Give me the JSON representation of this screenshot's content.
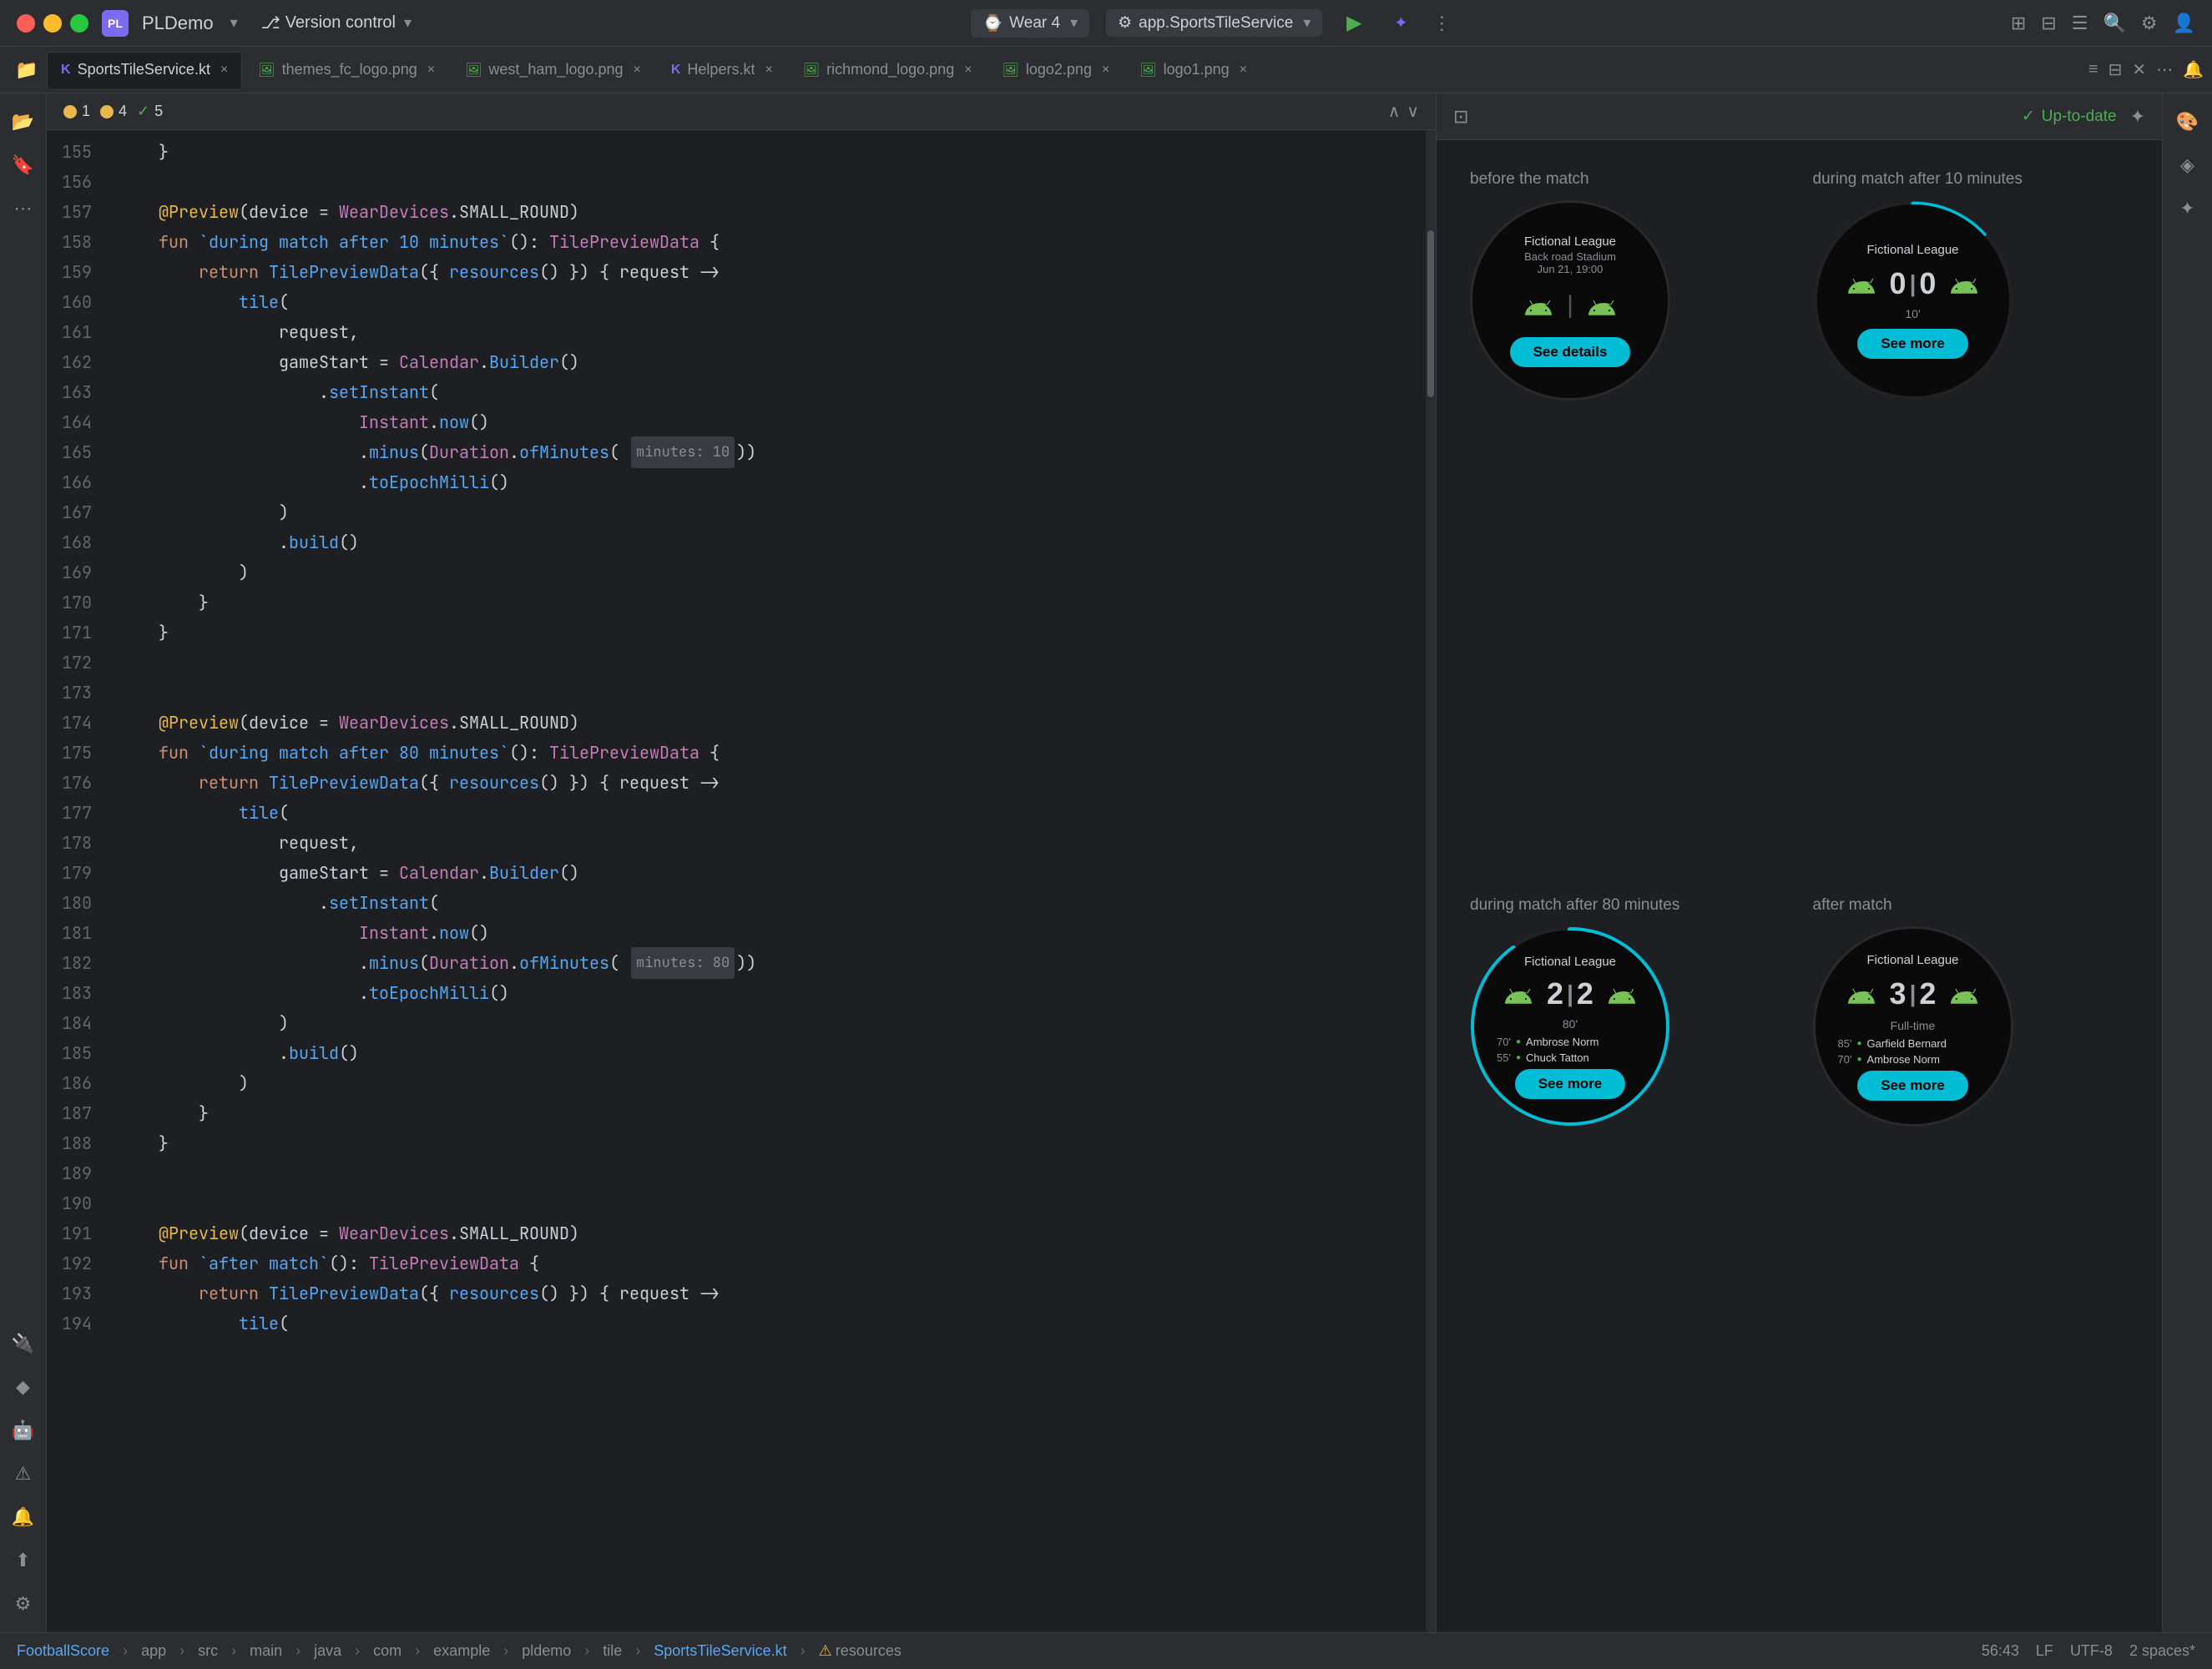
{
  "titlebar": {
    "traffic_lights": [
      "red",
      "yellow",
      "green"
    ],
    "app_icon_label": "PL",
    "app_name": "PLDemo",
    "version_control_label": "Version control",
    "device_label": "Wear 4",
    "service_label": "app.SportsTileService",
    "run_symbol": "▶",
    "debug_symbol": "✦",
    "more_symbol": "⋮"
  },
  "tabs": [
    {
      "label": "SportsTileService.kt",
      "type": "kt",
      "active": true
    },
    {
      "label": "themes_fc_logo.png",
      "type": "img",
      "active": false
    },
    {
      "label": "west_ham_logo.png",
      "type": "img",
      "active": false
    },
    {
      "label": "Helpers.kt",
      "type": "kt",
      "active": false
    },
    {
      "label": "richmond_logo.png",
      "type": "img",
      "active": false
    },
    {
      "label": "logo2.png",
      "type": "img",
      "active": false
    },
    {
      "label": "logo1.png",
      "type": "img",
      "active": false
    }
  ],
  "editor": {
    "error_counts": {
      "warning1": "1",
      "warning4": "4",
      "check5": "5"
    },
    "lines": [
      {
        "num": 155,
        "content": "    }"
      },
      {
        "num": 156,
        "content": ""
      },
      {
        "num": 157,
        "content": "    @Preview(device = WearDevices.SMALL_ROUND)"
      },
      {
        "num": 158,
        "content": "    fun `during match after 10 minutes`(): TilePreviewData {"
      },
      {
        "num": 159,
        "content": "        return TilePreviewData({ resources() }) { request ->"
      },
      {
        "num": 160,
        "content": "            tile("
      },
      {
        "num": 161,
        "content": "                request,"
      },
      {
        "num": 162,
        "content": "                gameStart = Calendar.Builder()"
      },
      {
        "num": 163,
        "content": "                    .setInstant("
      },
      {
        "num": 164,
        "content": "                        Instant.now()"
      },
      {
        "num": 165,
        "content": "                        .minus(Duration.ofMinutes( minutes: 10))"
      },
      {
        "num": 166,
        "content": "                        .toEpochMilli()"
      },
      {
        "num": 167,
        "content": "                )"
      },
      {
        "num": 168,
        "content": "                .build()"
      },
      {
        "num": 169,
        "content": "            )"
      },
      {
        "num": 170,
        "content": "        }"
      },
      {
        "num": 171,
        "content": "    }"
      },
      {
        "num": 172,
        "content": ""
      },
      {
        "num": 173,
        "content": ""
      },
      {
        "num": 174,
        "content": "    @Preview(device = WearDevices.SMALL_ROUND)"
      },
      {
        "num": 175,
        "content": "    fun `during match after 80 minutes`(): TilePreviewData {"
      },
      {
        "num": 176,
        "content": "        return TilePreviewData({ resources() }) { request ->"
      },
      {
        "num": 177,
        "content": "            tile("
      },
      {
        "num": 178,
        "content": "                request,"
      },
      {
        "num": 179,
        "content": "                gameStart = Calendar.Builder()"
      },
      {
        "num": 180,
        "content": "                    .setInstant("
      },
      {
        "num": 181,
        "content": "                        Instant.now()"
      },
      {
        "num": 182,
        "content": "                        .minus(Duration.ofMinutes( minutes: 80))"
      },
      {
        "num": 183,
        "content": "                        .toEpochMilli()"
      },
      {
        "num": 184,
        "content": "                )"
      },
      {
        "num": 185,
        "content": "                .build()"
      },
      {
        "num": 186,
        "content": "            )"
      },
      {
        "num": 187,
        "content": "        }"
      },
      {
        "num": 188,
        "content": "    }"
      },
      {
        "num": 189,
        "content": ""
      },
      {
        "num": 190,
        "content": ""
      },
      {
        "num": 191,
        "content": "    @Preview(device = WearDevices.SMALL_ROUND)"
      },
      {
        "num": 192,
        "content": "    fun `after match`(): TilePreviewData {"
      },
      {
        "num": 193,
        "content": "        return TilePreviewData({ resources() }) { request ->"
      },
      {
        "num": 194,
        "content": "            tile("
      }
    ]
  },
  "preview": {
    "up_to_date_label": "Up-to-date",
    "cells": [
      {
        "label": "before the match",
        "type": "before",
        "league": "Fictional League",
        "venue": "Back road Stadium",
        "date": "Jun 21, 19:00",
        "button": "See details"
      },
      {
        "label": "during match after 10 minutes",
        "type": "score",
        "league": "Fictional League",
        "score_home": "0",
        "score_away": "0",
        "minute": "10'",
        "button": "See more",
        "progress": 0.13
      },
      {
        "label": "during match after 80 minutes",
        "type": "score_scorers",
        "league": "Fictional League",
        "score_home": "2",
        "score_away": "2",
        "minute": "80'",
        "button": "See more",
        "scorers": [
          {
            "min": "70'",
            "name": "Ambrose Norm"
          },
          {
            "min": "55'",
            "name": "Chuck Tatton"
          }
        ],
        "progress": 0.89
      },
      {
        "label": "after match",
        "type": "score_scorers",
        "league": "Fictional League",
        "score_home": "3",
        "score_away": "2",
        "minute": "Full-time",
        "button": "See more",
        "scorers": [
          {
            "min": "85'",
            "name": "Garfield Bernard"
          },
          {
            "min": "70'",
            "name": "Ambrose Norm"
          }
        ],
        "progress": 1.0
      }
    ]
  },
  "statusbar": {
    "breadcrumb": [
      "FootballScore",
      "app",
      "src",
      "main",
      "java",
      "com",
      "example",
      "pldemo",
      "tile",
      "SportsTileService.kt",
      "resources"
    ],
    "position": "56:43",
    "encoding": "LF",
    "charset": "UTF-8",
    "indent": "2 spaces*"
  }
}
